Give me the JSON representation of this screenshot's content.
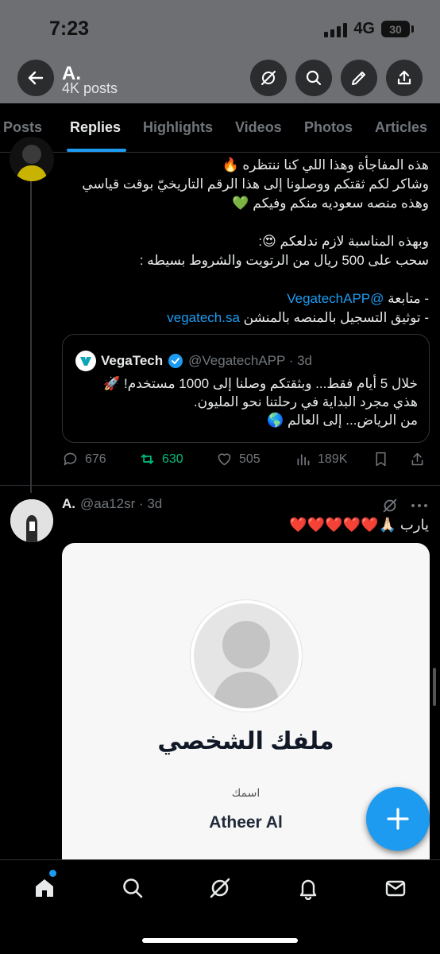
{
  "status_bar": {
    "time": "7:23",
    "network": "4G",
    "battery": "30"
  },
  "header": {
    "name": "A.",
    "posts": "4K posts"
  },
  "tabs": [
    {
      "label": "Posts"
    },
    {
      "label": "Replies"
    },
    {
      "label": "Highlights"
    },
    {
      "label": "Videos"
    },
    {
      "label": "Photos"
    },
    {
      "label": "Articles"
    }
  ],
  "tweet1": {
    "lines": [
      "هذه المفاجأة وهذا اللي كنا ننتظره 🔥",
      "وشاكر لكم ثقتكم ووصلونا إلى هذا الرقم التاريخيّ بوقت قياسي",
      "وهذه منصه سعوديه منكم وفيكم 💚",
      "وبهذه المناسبة لازم ندلعكم 😍:",
      "سحب على 500 ريال من الرتويت والشروط بسيطه :"
    ],
    "follow_prefix": "- متابعة ",
    "follow_link": "@VegatechAPP",
    "verify_prefix": "- توثيق التسجيل بالمنصه بالمنشن ",
    "verify_link": "vegatech.sa",
    "quote": {
      "name": "VegaTech",
      "handle_time": "@VegatechAPP · 3d",
      "lines": [
        "خلال 5 أيام فقط... وبثقتكم وصلنا إلى 1000 مستخدم! 🚀",
        "هذي مجرد البداية في رحلتنا نحو المليون.",
        "من الرياض... إلى العالم 🌎"
      ]
    },
    "stats": {
      "replies": "676",
      "retweets": "630",
      "likes": "505",
      "views": "189K"
    }
  },
  "tweet2": {
    "name": "A.",
    "handle_time": "@aa12sr · 3d",
    "text": "يارب 🙏🏻❤️❤️❤️❤️❤️",
    "card": {
      "title": "ملفك الشخصي",
      "label": "اسمك",
      "name": "Atheer Al"
    }
  },
  "colors": {
    "accent": "#1d9bf0",
    "retweet_active": "#00ba7c",
    "verified": "#1d9bf0"
  },
  "icons": {
    "back": "arrow-left-icon",
    "grok": "grok-icon",
    "search": "search-icon",
    "edit": "pencil-icon",
    "share": "share-icon",
    "reply": "reply-icon",
    "retweet": "retweet-icon",
    "like": "heart-icon",
    "views": "views-icon",
    "bookmark": "bookmark-icon",
    "more": "more-icon",
    "compose": "plus-icon",
    "home": "home-icon",
    "notifications": "bell-icon",
    "messages": "mail-icon"
  }
}
